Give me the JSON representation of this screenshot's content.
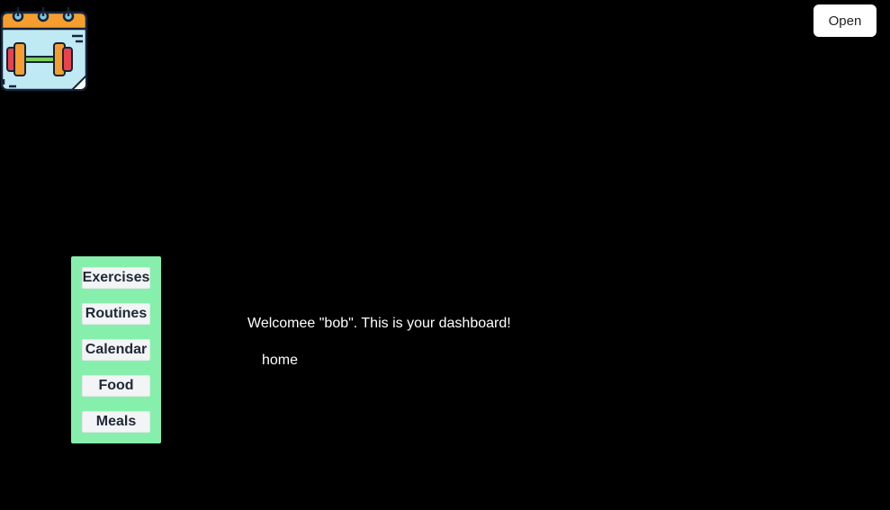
{
  "header": {
    "logo_icon": "calendar-dumbbell-icon",
    "open_label": "Open"
  },
  "sidebar": {
    "background": "#86efac",
    "items": [
      {
        "label": "Exercises"
      },
      {
        "label": "Routines"
      },
      {
        "label": "Calendar"
      },
      {
        "label": "Food"
      },
      {
        "label": "Meals"
      }
    ]
  },
  "main": {
    "welcome_text": "Welcomee \"bob\". This is your dashboard!",
    "page_label": "home"
  }
}
